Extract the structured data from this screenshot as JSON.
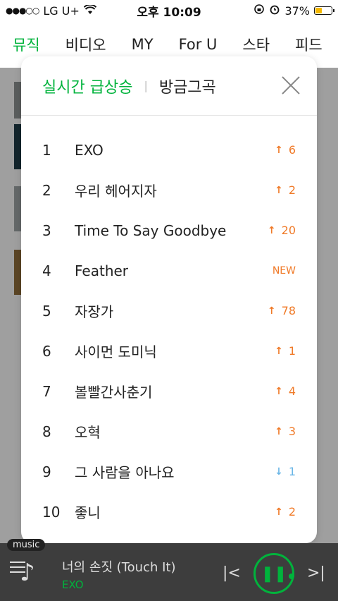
{
  "status_bar": {
    "signal": "●●●○○",
    "carrier": "LG U+",
    "time": "오후 10:09",
    "battery": "37%"
  },
  "top_nav": {
    "tabs": [
      "뮤직",
      "비디오",
      "MY",
      "For U",
      "스타",
      "피드"
    ]
  },
  "modal": {
    "tab_rising": "실시간 급상승",
    "tab_separator": "|",
    "tab_now": "방금그곡",
    "items": [
      {
        "rank": "1",
        "title": "EXO",
        "change": "6",
        "dir": "up"
      },
      {
        "rank": "2",
        "title": "우리 헤어지자",
        "change": "2",
        "dir": "up"
      },
      {
        "rank": "3",
        "title": "Time To Say Goodbye",
        "change": "20",
        "dir": "up"
      },
      {
        "rank": "4",
        "title": "Feather",
        "change": "NEW",
        "dir": "new"
      },
      {
        "rank": "5",
        "title": "자장가",
        "change": "78",
        "dir": "up"
      },
      {
        "rank": "6",
        "title": "사이먼 도미닉",
        "change": "1",
        "dir": "up"
      },
      {
        "rank": "7",
        "title": "볼빨간사춘기",
        "change": "4",
        "dir": "up"
      },
      {
        "rank": "8",
        "title": "오혁",
        "change": "3",
        "dir": "up"
      },
      {
        "rank": "9",
        "title": "그 사람을 아나요",
        "change": "1",
        "dir": "down"
      },
      {
        "rank": "10",
        "title": "좋니",
        "change": "2",
        "dir": "up"
      }
    ]
  },
  "player": {
    "tag": "music",
    "song_title": "너의 손짓 (Touch It)",
    "artist": "EXO"
  },
  "colors": {
    "accent_green": "#00b33c",
    "up_orange": "#f07a28",
    "down_blue": "#6ab6e6"
  }
}
